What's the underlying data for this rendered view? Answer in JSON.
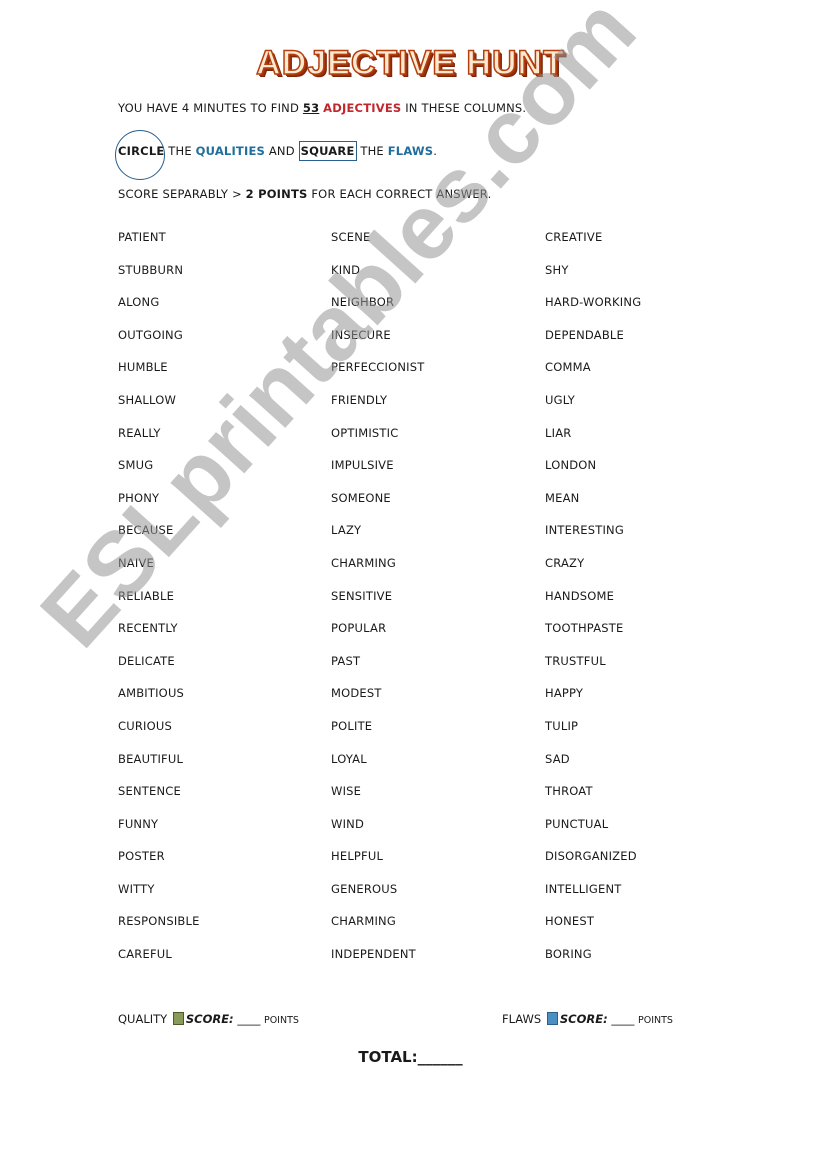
{
  "title": "ADJECTIVE HUNT",
  "instructions": {
    "line1_pre": "YOU HAVE 4 MINUTES TO FIND ",
    "line1_count": "53",
    "line1_keyword": "ADJECTIVES",
    "line1_post": " IN THESE COLUMNS.",
    "line2_circle": "CIRCLE",
    "line2_the1": " THE ",
    "line2_qualities": "QUALITIES",
    "line2_and": " AND ",
    "line2_square": "SQUARE",
    "line2_the2": " THE ",
    "line2_flaws": "FLAWS",
    "line2_end": ".",
    "line3_pre": "SCORE SEPARABLY > ",
    "line3_points": "2 POINTS",
    "line3_post": " FOR EACH CORRECT ANSWER."
  },
  "columns": [
    [
      "PATIENT",
      "STUBBURN",
      "ALONG",
      "OUTGOING",
      "HUMBLE",
      "SHALLOW",
      "REALLY",
      "SMUG",
      "PHONY",
      "BECAUSE",
      "NAIVE",
      "RELIABLE",
      "RECENTLY",
      "DELICATE",
      "AMBITIOUS",
      "CURIOUS",
      "BEAUTIFUL",
      "SENTENCE",
      "FUNNY",
      "POSTER",
      "WITTY",
      "RESPONSIBLE",
      "CAREFUL"
    ],
    [
      "SCENE",
      "KIND",
      "NEIGHBOR",
      "INSECURE",
      "PERFECCIONIST",
      "FRIENDLY",
      "OPTIMISTIC",
      "IMPULSIVE",
      "SOMEONE",
      "LAZY",
      "CHARMING",
      "SENSITIVE",
      "POPULAR",
      "PAST",
      "MODEST",
      "POLITE",
      "LOYAL",
      "WISE",
      "WIND",
      "HELPFUL",
      "GENEROUS",
      "CHARMING",
      "INDEPENDENT"
    ],
    [
      "CREATIVE",
      "SHY",
      "HARD-WORKING",
      "DEPENDABLE",
      "COMMA",
      "UGLY",
      "LIAR",
      "LONDON",
      "MEAN",
      "INTERESTING",
      "CRAZY",
      "HANDSOME",
      "TOOTHPASTE",
      "TRUSTFUL",
      "HAPPY",
      "TULIP",
      "SAD",
      "THROAT",
      "PUNCTUAL",
      "DISORGANIZED",
      "INTELLIGENT",
      "HONEST",
      "BORING"
    ]
  ],
  "footer": {
    "quality_label": "QUALITY",
    "flaws_label": "FLAWS",
    "score_label": "SCORE:",
    "blank": "____",
    "points_label": "POINTS",
    "total": "TOTAL:______"
  },
  "watermark": "ESLprintables.com"
}
